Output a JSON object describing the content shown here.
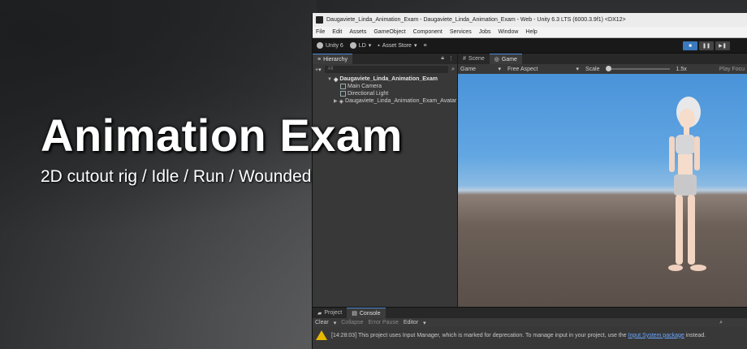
{
  "overlay": {
    "title": "Animation Exam",
    "subtitle": "2D cutout rig / Idle / Run / Wounded"
  },
  "window": {
    "title": "Daugaviete_Linda_Animation_Exam - Daugaviete_Linda_Animation_Exam - Web - Unity 6.3 LTS (6000.3.9f1) <DX12>"
  },
  "menubar": [
    "File",
    "Edit",
    "Assets",
    "GameObject",
    "Component",
    "Services",
    "Jobs",
    "Window",
    "Help"
  ],
  "toolbar": {
    "unity_label": "Unity 6",
    "account_label": "LD",
    "asset_store_label": "Asset Store"
  },
  "hierarchy": {
    "tab_label": "Hierarchy",
    "search_placeholder": "All",
    "scene_name": "Daugaviete_Linda_Animation_Exam",
    "items": [
      "Main Camera",
      "Directional Light"
    ],
    "avatar_item": "Daugaviete_Linda_Animation_Exam_Avatar"
  },
  "game_tabs": {
    "scene_label": "Scene",
    "game_label": "Game"
  },
  "game_toolbar": {
    "display": "Game",
    "aspect": "Free Aspect",
    "scale_label": "Scale",
    "scale_value": "1.5x",
    "play_focused": "Play Focu"
  },
  "bottom_tabs": {
    "project_label": "Project",
    "console_label": "Console"
  },
  "console_toolbar": {
    "clear": "Clear",
    "collapse": "Collapse",
    "error_pause": "Error Pause",
    "editor": "Editor"
  },
  "console": {
    "message_prefix": "[14:28:03] This project uses Input Manager, which is marked for deprecation. To manage input in your project, use the",
    "link_text": "Input System package",
    "message_suffix": "instead."
  },
  "colors": {
    "sky_top": "#4a93d9",
    "ground": "#6c6059",
    "accent": "#3a79bd",
    "warning": "#e6b800"
  }
}
